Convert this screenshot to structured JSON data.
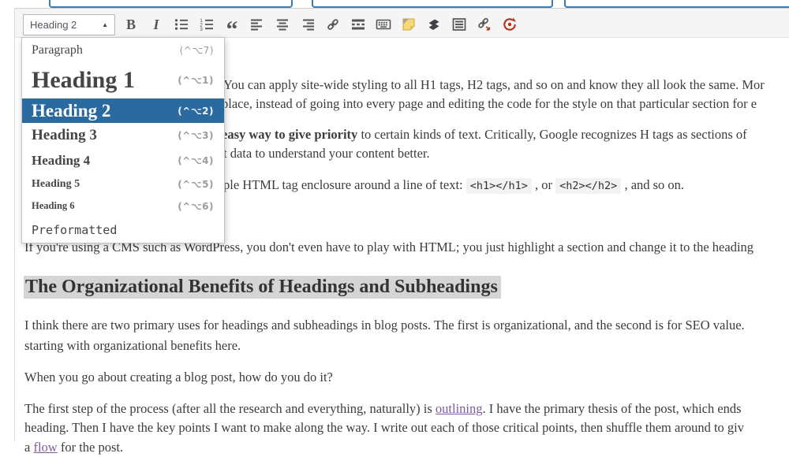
{
  "colors": {
    "accent_blue": "#2a6a9f",
    "selection_gray": "#d5d5d5",
    "link_purple": "#7e5b9e",
    "history_red": "#b5351f",
    "note_yellow": "#f8d876",
    "icon_gray": "#555555"
  },
  "editor": {
    "format_select": {
      "value": "Heading 2",
      "caret": "▲"
    },
    "toolbar_icons": [
      {
        "name": "bold-icon"
      },
      {
        "name": "italic-icon"
      },
      {
        "name": "bullet-list-icon"
      },
      {
        "name": "numbered-list-icon"
      },
      {
        "name": "blockquote-icon"
      },
      {
        "name": "align-left-icon"
      },
      {
        "name": "align-center-icon"
      },
      {
        "name": "align-right-icon"
      },
      {
        "name": "link-icon"
      },
      {
        "name": "more-tag-icon"
      },
      {
        "name": "keyboard-icon"
      },
      {
        "name": "note-icon"
      },
      {
        "name": "stack-icon"
      },
      {
        "name": "toc-icon"
      },
      {
        "name": "link-arrow-icon"
      },
      {
        "name": "history-icon"
      }
    ],
    "format_dropdown": {
      "items": [
        {
          "label": "Paragraph",
          "shortcut": "(^⌥7)",
          "style": "p",
          "selected": false
        },
        {
          "label": "Heading 1",
          "shortcut": "(^⌥1)",
          "style": "h1",
          "selected": false
        },
        {
          "label": "Heading 2",
          "shortcut": "(^⌥2)",
          "style": "h2",
          "selected": true
        },
        {
          "label": "Heading 3",
          "shortcut": "(^⌥3)",
          "style": "h3",
          "selected": false
        },
        {
          "label": "Heading 4",
          "shortcut": "(^⌥4)",
          "style": "h4",
          "selected": false
        },
        {
          "label": "Heading 5",
          "shortcut": "(^⌥5)",
          "style": "h5",
          "selected": false
        },
        {
          "label": "Heading 6",
          "shortcut": "(^⌥6)",
          "style": "h6",
          "selected": false
        },
        {
          "label": "Preformatted",
          "shortcut": "",
          "style": "pre",
          "selected": false
        }
      ]
    }
  },
  "content": {
    "lines": [
      {
        "segments": [
          {
            "text": "You can apply site-wide styling to all H1 tags, H2 tags, and so on and know they all look the same. Mor"
          }
        ]
      },
      {
        "segments": [
          {
            "text": "place, instead of going into every page and editing the code for the style on that particular section for e"
          }
        ]
      },
      {
        "segments": [
          {
            "text": "easy way to give priority",
            "bold": true
          },
          {
            "text": " to certain kinds of text. Critically, Google recognizes H tags as sections of"
          }
        ]
      },
      {
        "segments": [
          {
            "text": "t data to understand your content better."
          }
        ]
      },
      {
        "segments": [
          {
            "text": "ple HTML tag enclosure around a line of text: "
          },
          {
            "text": "<h1></h1>",
            "code": true
          },
          {
            "text": " , or "
          },
          {
            "text": "<h2></h2>",
            "code": true
          },
          {
            "text": " , and so on."
          }
        ]
      },
      {
        "segments": [
          {
            "text": "If you're using a CMS such as WordPress, you don't even have to play with HTML; you just highlight a section and change it to the heading"
          }
        ]
      },
      {
        "type": "heading",
        "segments": [
          {
            "text": "The Organizational Benefits of Headings and Subheadings"
          }
        ]
      },
      {
        "segments": [
          {
            "text": "I think there are two primary uses for headings and subheadings in blog posts. The first is organizational, and the second is for SEO value."
          }
        ]
      },
      {
        "segments": [
          {
            "text": "starting with organizational benefits here."
          }
        ]
      },
      {
        "segments": [
          {
            "text": "When you go about creating a blog post, how do you do it?"
          }
        ]
      },
      {
        "segments": [
          {
            "text": "The first step of the process (after all the research and everything, naturally) is "
          },
          {
            "text": "outlining",
            "link": true
          },
          {
            "text": ". I have the primary thesis of the post, which ends"
          }
        ]
      },
      {
        "segments": [
          {
            "text": "heading. Then I have the key points I want to make along the way. I write out each of those critical points, then shuffle them around to giv"
          }
        ]
      },
      {
        "segments": [
          {
            "text": "a "
          },
          {
            "text": "flow",
            "link": true
          },
          {
            "text": " for the post."
          }
        ]
      }
    ]
  }
}
